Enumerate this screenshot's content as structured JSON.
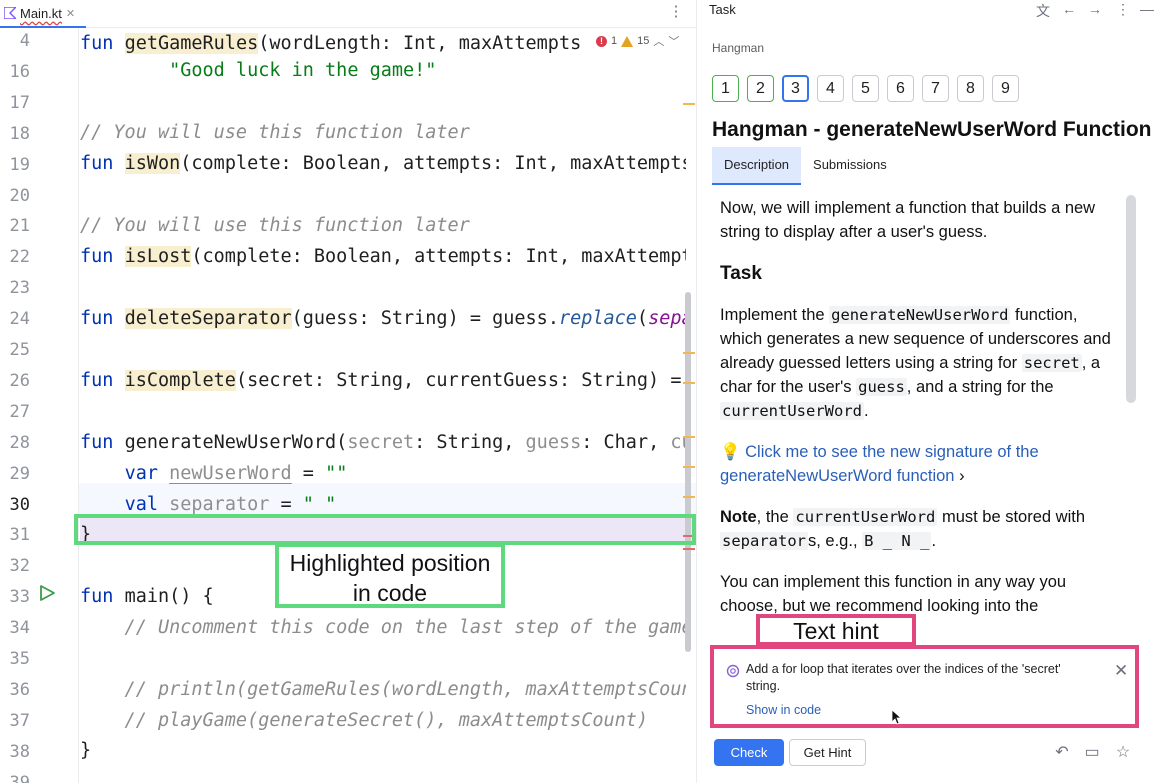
{
  "editor": {
    "file_tab": "Main.kt",
    "inspections": {
      "errors": "1",
      "warnings": "15"
    }
  },
  "code_lines": [
    {
      "num": "4",
      "text": "fun getGameRules(wordLength: Int, maxAttempts"
    },
    {
      "num": "16",
      "text": "        \"Good luck in the game!\""
    },
    {
      "num": "17",
      "text": ""
    },
    {
      "num": "18",
      "text": "// You will use this function later"
    },
    {
      "num": "19",
      "text": "fun isWon(complete: Boolean, attempts: Int, maxAttempts"
    },
    {
      "num": "20",
      "text": ""
    },
    {
      "num": "21",
      "text": "// You will use this function later"
    },
    {
      "num": "22",
      "text": "fun isLost(complete: Boolean, attempts: Int, maxAttempt"
    },
    {
      "num": "23",
      "text": ""
    },
    {
      "num": "24",
      "text": "fun deleteSeparator(guess: String) = guess.replace(sepa"
    },
    {
      "num": "25",
      "text": ""
    },
    {
      "num": "26",
      "text": "fun isComplete(secret: String, currentGuess: String) ="
    },
    {
      "num": "27",
      "text": ""
    },
    {
      "num": "28",
      "text": "fun generateNewUserWord(secret: String, guess: Char, cu"
    },
    {
      "num": "29",
      "text": "    var newUserWord = \"\""
    },
    {
      "num": "30",
      "text": "    val separator = \" \""
    },
    {
      "num": "31",
      "text": "}"
    },
    {
      "num": "32",
      "text": ""
    },
    {
      "num": "33",
      "text": "fun main() {"
    },
    {
      "num": "34",
      "text": "    // Uncomment this code on the last step of the game"
    },
    {
      "num": "35",
      "text": ""
    },
    {
      "num": "36",
      "text": "    // println(getGameRules(wordLength, maxAttemptsCoun"
    },
    {
      "num": "37",
      "text": "    // playGame(generateSecret(), maxAttemptsCount)"
    },
    {
      "num": "38",
      "text": "}"
    },
    {
      "num": "39",
      "text": ""
    }
  ],
  "annotations": {
    "highlighted": "Highlighted position in code",
    "text_hint": "Text hint"
  },
  "task": {
    "panel_title": "Task",
    "course": "Hangman",
    "steps": [
      "1",
      "2",
      "3",
      "4",
      "5",
      "6",
      "7",
      "8",
      "9"
    ],
    "active_step": "3",
    "title": "Hangman - generateNewUserWord Function",
    "tabs": [
      "Description",
      "Submissions"
    ],
    "description": {
      "p1": "Now, we will implement a function that builds a new string to display after a user's guess.",
      "heading": "Task",
      "p2_a": "Implement the ",
      "p2_code1": "generateNewUserWord",
      "p2_b": " function, which generates a new sequence of underscores and already guessed letters using a string for ",
      "p2_code2": "secret",
      "p2_c": ", a char for the user's ",
      "p2_code3": "guess",
      "p2_d": ", and a string for the ",
      "p2_code4": "currentUserWord",
      "p2_e": ".",
      "link": "Click me to see the new signature of the generateNewUserWord function",
      "note_bold": "Note",
      "note_a": ", the ",
      "note_code1": "currentUserWord",
      "note_b": " must be stored with ",
      "note_code2": "separator",
      "note_c": "s, e.g., ",
      "note_code3": "B _ N _",
      "note_d": ".",
      "p4": "You can implement this function in any way you choose, but we recommend looking into the"
    },
    "hint": {
      "text": "Add a for loop that iterates over the indices of the 'secret' string.",
      "link": "Show in code"
    },
    "buttons": {
      "check": "Check",
      "get_hint": "Get Hint"
    }
  }
}
